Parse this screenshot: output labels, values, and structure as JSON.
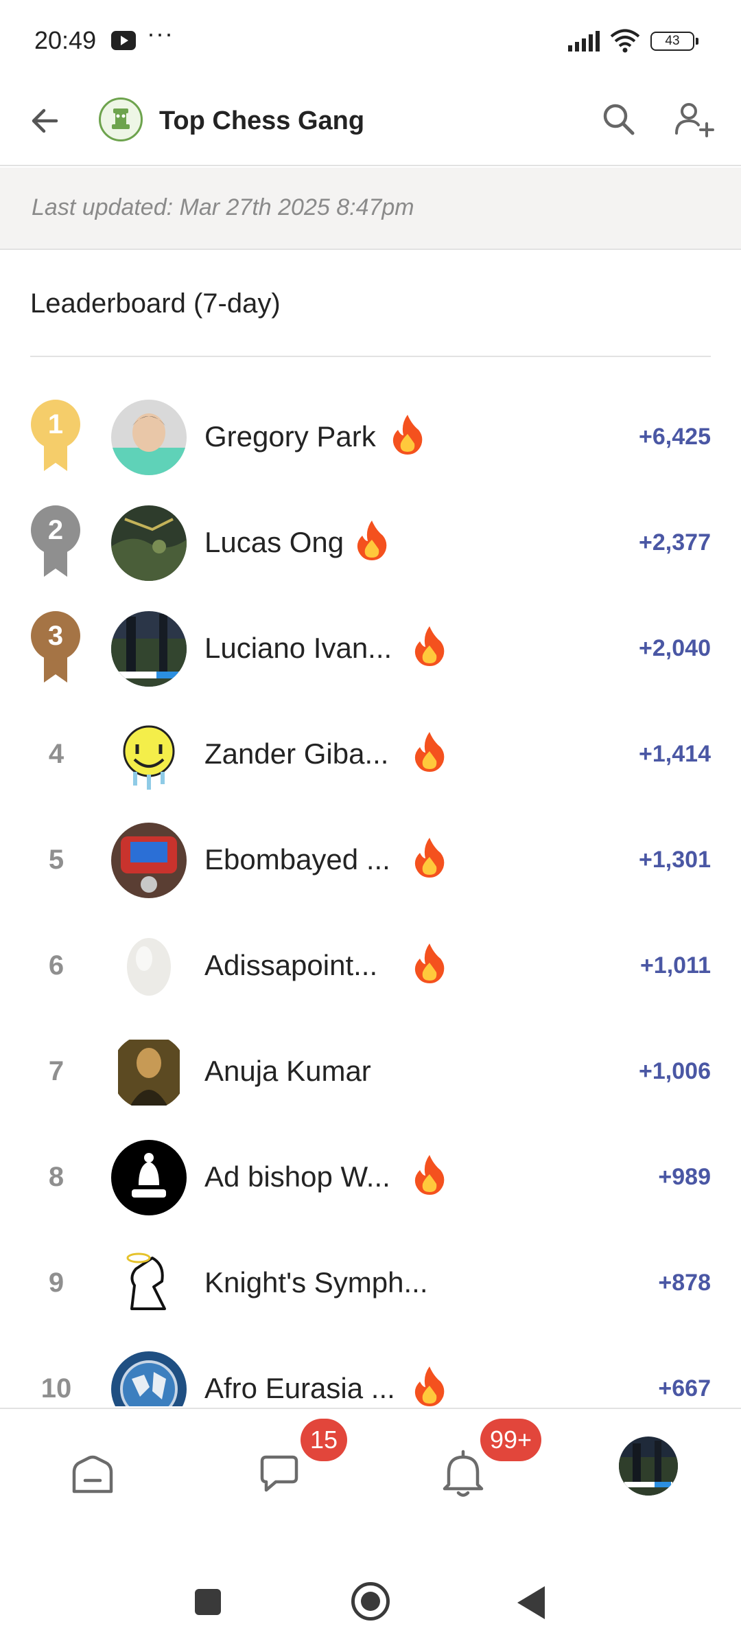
{
  "status_bar": {
    "time": "20:49",
    "more": "···",
    "battery": "43"
  },
  "header": {
    "title": "Top Chess Gang"
  },
  "updated": "Last updated: Mar 27th 2025 8:47pm",
  "leaderboard": {
    "title": "Leaderboard (7-day)",
    "rows": [
      {
        "rank": "1",
        "name": "Gregory Park",
        "score": "+6,425",
        "streak": true,
        "medal": "gold",
        "avatar": "teal"
      },
      {
        "rank": "2",
        "name": "Lucas Ong",
        "score": "+2,377",
        "streak": true,
        "medal": "silver",
        "avatar": "map"
      },
      {
        "rank": "3",
        "name": "Luciano Ivan...",
        "score": "+2,040",
        "streak": true,
        "medal": "bronze",
        "avatar": "forest"
      },
      {
        "rank": "4",
        "name": "Zander Giba...",
        "score": "+1,414",
        "streak": true,
        "medal": "",
        "avatar": "smiley"
      },
      {
        "rank": "5",
        "name": "Ebombayed ...",
        "score": "+1,301",
        "streak": true,
        "medal": "",
        "avatar": "game"
      },
      {
        "rank": "6",
        "name": "Adissapoint...",
        "score": "+1,011",
        "streak": true,
        "medal": "",
        "avatar": "egg"
      },
      {
        "rank": "7",
        "name": "Anuja Kumar",
        "score": "+1,006",
        "streak": false,
        "medal": "",
        "avatar": "painting"
      },
      {
        "rank": "8",
        "name": "Ad bishop W...",
        "score": "+989",
        "streak": true,
        "medal": "",
        "avatar": "bishop"
      },
      {
        "rank": "9",
        "name": "Knight's Symph...",
        "score": "+878",
        "streak": false,
        "medal": "",
        "avatar": "knight"
      },
      {
        "rank": "10",
        "name": "Afro Eurasia ...",
        "score": "+667",
        "streak": true,
        "medal": "",
        "avatar": "globe"
      }
    ]
  },
  "bottom_nav": {
    "chat_badge": "15",
    "notif_badge": "99+"
  },
  "colors": {
    "score": "#4a57a4",
    "gold": "#f5cd6a",
    "silver": "#8f8f8f",
    "bronze": "#a57445",
    "badge": "#e2463b",
    "club_green": "#6da34d"
  }
}
